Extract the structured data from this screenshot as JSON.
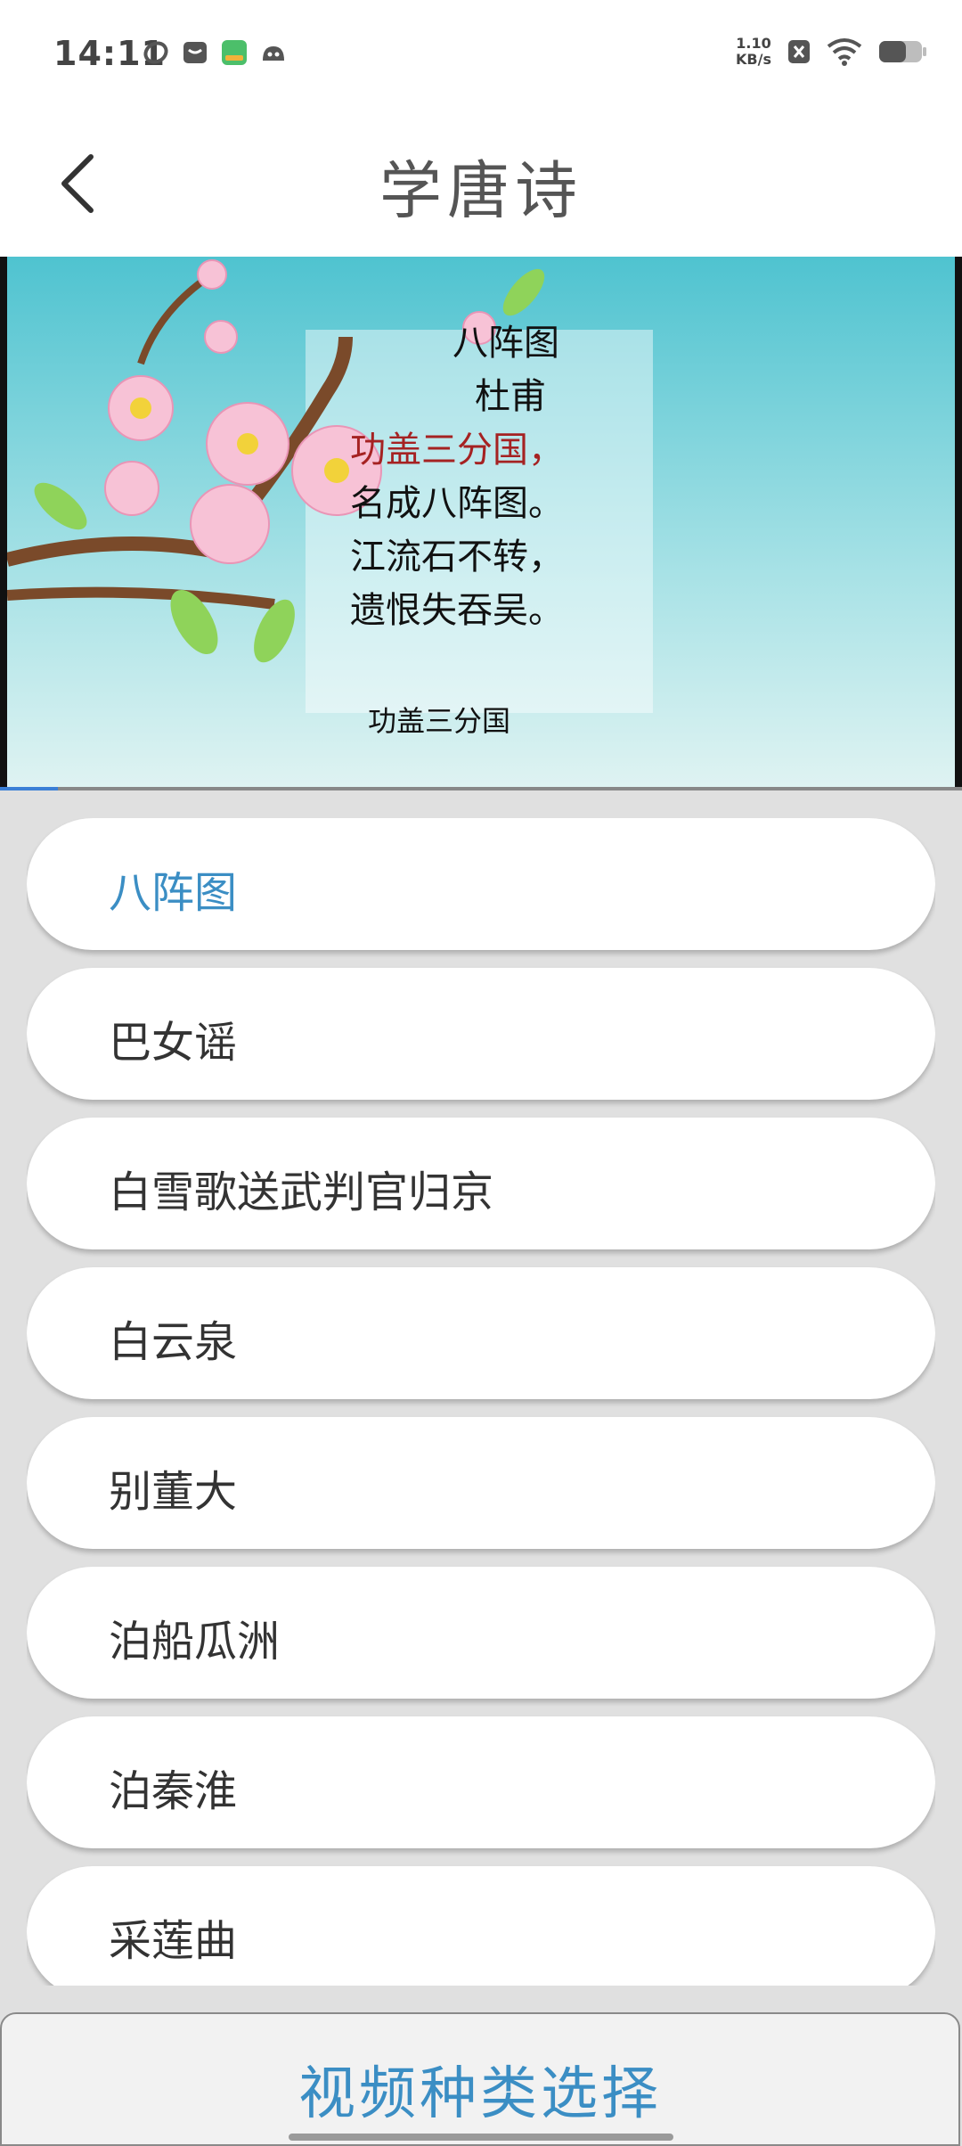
{
  "status_bar": {
    "time": "14:11",
    "net_speed_value": "1.10",
    "net_speed_unit": "KB/s",
    "icons": [
      "app-icon-1",
      "app-icon-2",
      "app-icon-3",
      "app-icon-4",
      "close-notification-icon",
      "wifi-icon",
      "battery-icon"
    ]
  },
  "header": {
    "title": "学唐诗"
  },
  "video": {
    "poem_title": "八阵图",
    "author": "杜甫",
    "lines": [
      "功盖三分国，",
      "名成八阵图。",
      "江流石不转，",
      "遗恨失吞吴。"
    ],
    "highlighted_line": 0,
    "subtitle": "功盖三分国",
    "progress": 0.06
  },
  "list": {
    "active_index": 0,
    "items": [
      "八阵图",
      "巴女谣",
      "白雪歌送武判官归京",
      "白云泉",
      "别董大",
      "泊船瓜洲",
      "泊秦淮",
      "采莲曲"
    ]
  },
  "bottom_button": {
    "label": "视频种类选择"
  },
  "colors": {
    "accent": "#3b8ec4",
    "highlight_line": "#a52222"
  }
}
